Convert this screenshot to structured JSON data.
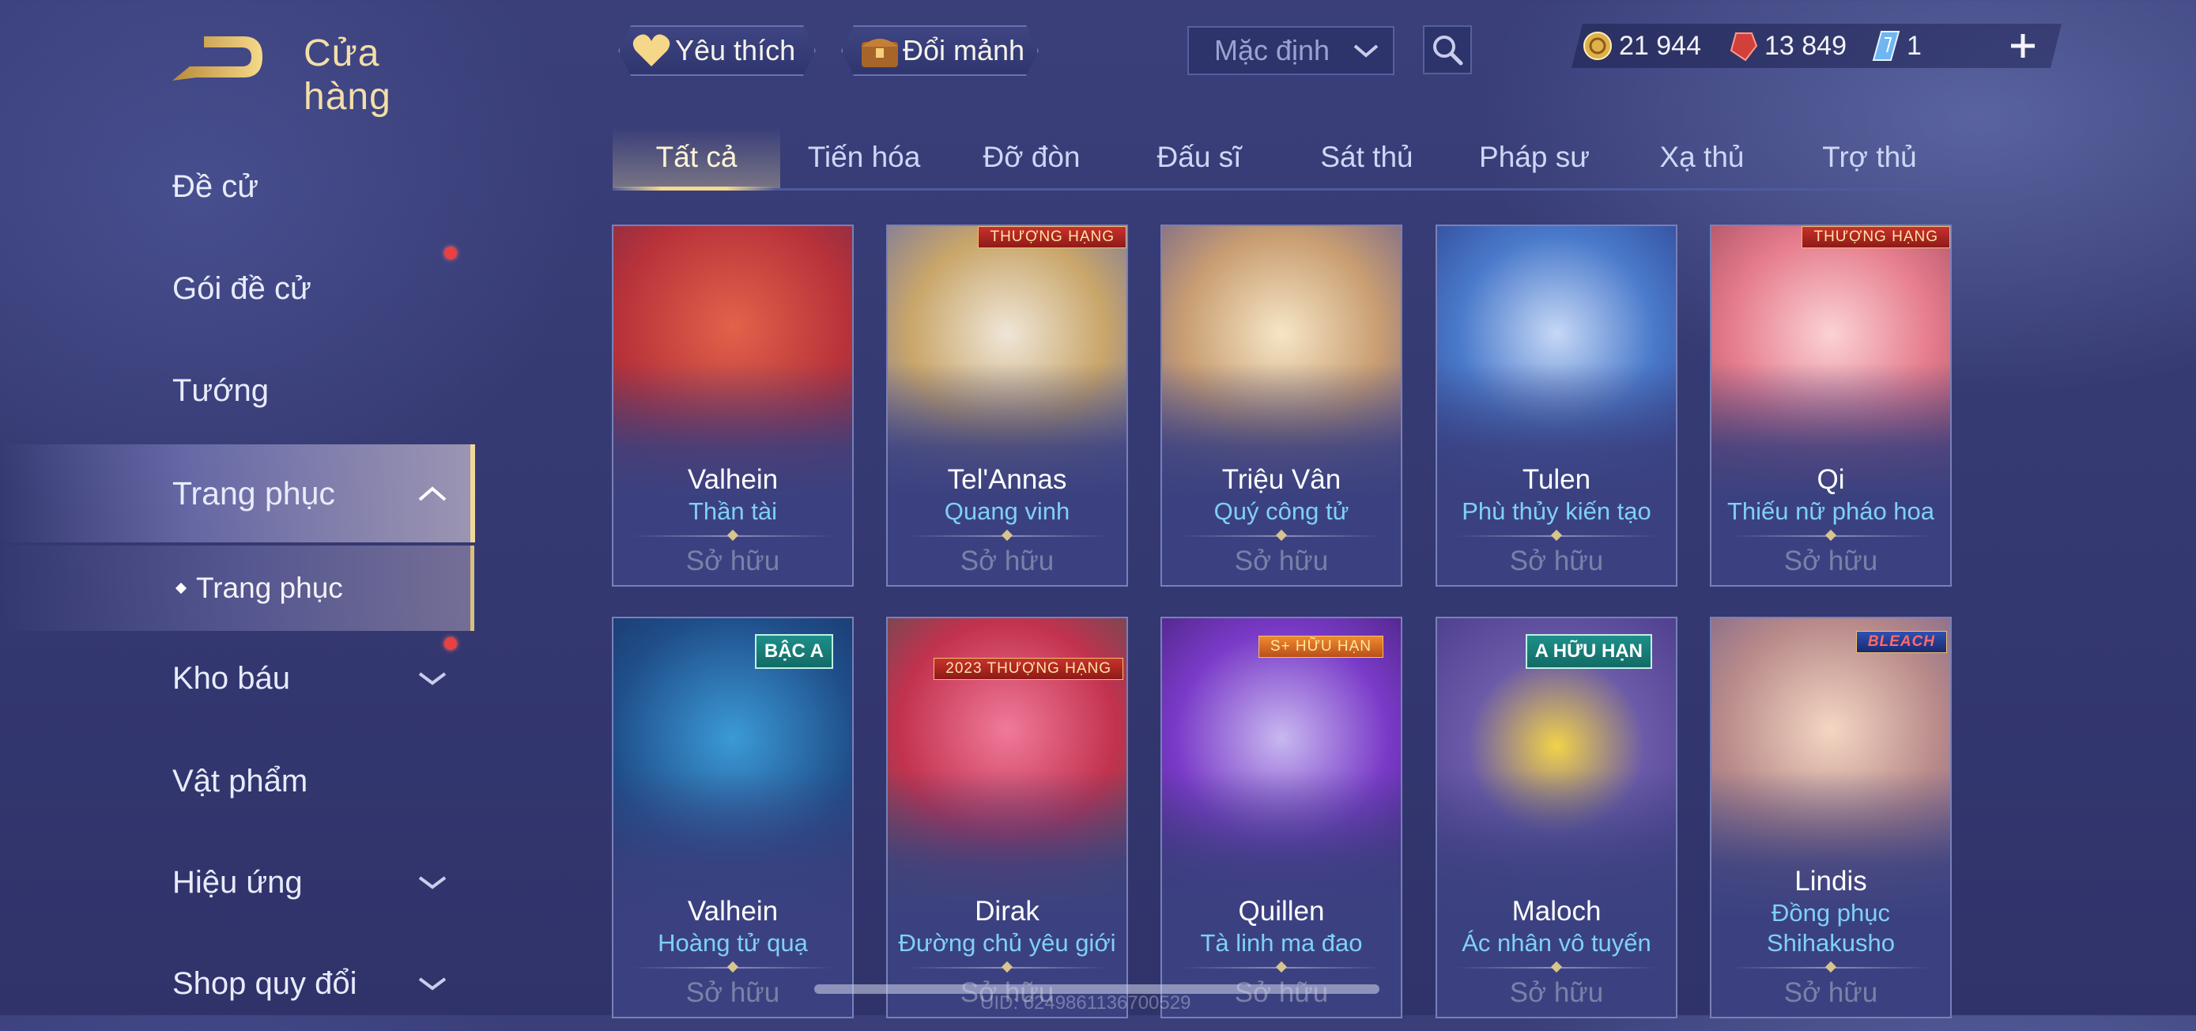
{
  "header": {
    "title": "Cửa hàng",
    "favorites_label": "Yêu thích",
    "exchange_label": "Đổi mảnh",
    "sort_value": "Mặc định"
  },
  "currency": {
    "gold": "21 944",
    "vouchers": "13 849",
    "tickets": "1"
  },
  "sidebar": {
    "items": [
      {
        "label": "Đề cử"
      },
      {
        "label": "Gói đề cử"
      },
      {
        "label": "Tướng"
      },
      {
        "label": "Trang phục"
      },
      {
        "label": "Kho báu"
      },
      {
        "label": "Vật phẩm"
      },
      {
        "label": "Hiệu ứng"
      },
      {
        "label": "Shop quy đổi"
      }
    ],
    "sub_item": "Trang phục"
  },
  "tabs": [
    "Tất cả",
    "Tiến hóa",
    "Đỡ đòn",
    "Đấu sĩ",
    "Sát thủ",
    "Pháp sư",
    "Xạ thủ",
    "Trợ thủ"
  ],
  "cards": [
    {
      "hero": "Valhein",
      "skin": "Thần tài",
      "status": "Sở hữu"
    },
    {
      "hero": "Tel'Annas",
      "skin": "Quang vinh",
      "status": "Sở hữu",
      "badge": "THƯỢNG HẠNG"
    },
    {
      "hero": "Triệu Vân",
      "skin": "Quý công tử",
      "status": "Sở hữu"
    },
    {
      "hero": "Tulen",
      "skin": "Phù thủy kiến tạo",
      "status": "Sở hữu"
    },
    {
      "hero": "Qi",
      "skin": "Thiếu nữ pháo hoa",
      "status": "Sở hữu",
      "badge": "THƯỢNG HẠNG"
    },
    {
      "hero": "Valhein",
      "skin": "Hoàng tử quạ",
      "status": "Sở hữu",
      "badge": "BẬC A"
    },
    {
      "hero": "Dirak",
      "skin": "Đường chủ yêu giới",
      "status": "Sở hữu",
      "badge": "2023 THƯỢNG HẠNG"
    },
    {
      "hero": "Quillen",
      "skin": "Tà linh ma đao",
      "status": "Sở hữu",
      "badge": "S+ HỮU HẠN"
    },
    {
      "hero": "Maloch",
      "skin": "Ác nhân vô tuyến",
      "status": "Sở hữu",
      "badge": "A HỮU HẠN"
    },
    {
      "hero": "Lindis",
      "skin": "Đồng phục Shihakusho",
      "status": "Sở hữu",
      "badge": "BLEACH"
    }
  ],
  "footer": {
    "uid": "UID: 6249861136700529"
  },
  "colors": {
    "accent_gold": "#f0d89a",
    "skin_name": "#7fd0f7",
    "notification": "#e8413f"
  }
}
